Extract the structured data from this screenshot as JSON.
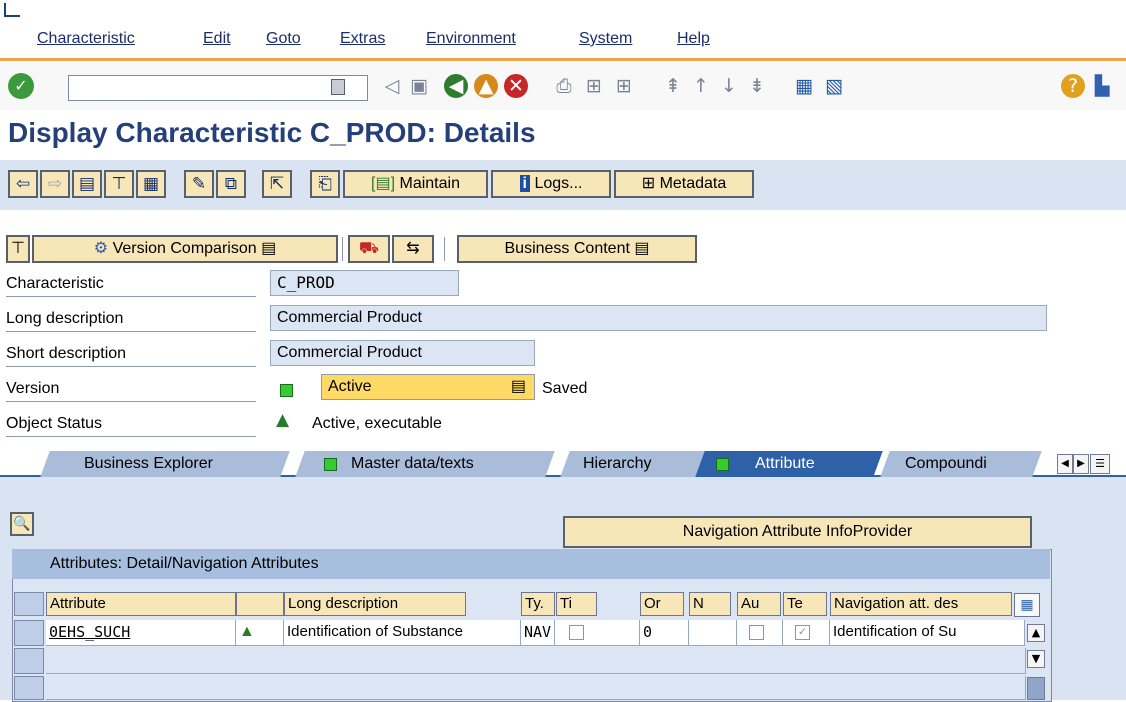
{
  "menu": [
    "Characteristic",
    "Edit",
    "Goto",
    "Extras",
    "Environment",
    "System",
    "Help"
  ],
  "command_field": {
    "value": ""
  },
  "title": "Display Characteristic C_PROD: Details",
  "app_toolbar": {
    "maintain_label": "Maintain",
    "logs_label": "Logs...",
    "metadata_label": "Metadata"
  },
  "sub_toolbar": {
    "version_comparison": "Version Comparison",
    "business_content": "Business Content"
  },
  "form": {
    "characteristic_label": "Characteristic",
    "characteristic_value": "C_PROD",
    "long_desc_label": "Long description",
    "long_desc_value": "Commercial Product",
    "short_desc_label": "Short description",
    "short_desc_value": "Commercial Product",
    "version_label": "Version",
    "version_value": "Active",
    "version_status": "Saved",
    "object_status_label": "Object Status",
    "object_status_value": "Active, executable"
  },
  "tabs": [
    {
      "label": "Business Explorer",
      "led": false
    },
    {
      "label": "Master data/texts",
      "led": true
    },
    {
      "label": "Hierarchy",
      "led": false
    },
    {
      "label": "Attribute",
      "led": true,
      "selected": true
    },
    {
      "label": "Compoundi",
      "led": false
    }
  ],
  "nav_attr_button": "Navigation Attribute InfoProvider",
  "grid": {
    "title": "Attributes: Detail/Navigation Attributes",
    "columns": [
      "Attribute",
      "",
      "Long description",
      "Ty.",
      "Ti",
      "Or",
      "N",
      "Au",
      "Te",
      "Navigation att. des"
    ],
    "rows": [
      {
        "attribute": "0EHS_SUCH",
        "long_description": "Identification of Substance",
        "type": "NAV",
        "order": "0",
        "nav_desc": "Identification of Su"
      }
    ]
  },
  "colors": {
    "accent": "#f0a24a",
    "title": "#253f7a",
    "panel": "#dae3f2",
    "button": "#f6e6b8",
    "selected_tab": "#2e61a8"
  }
}
